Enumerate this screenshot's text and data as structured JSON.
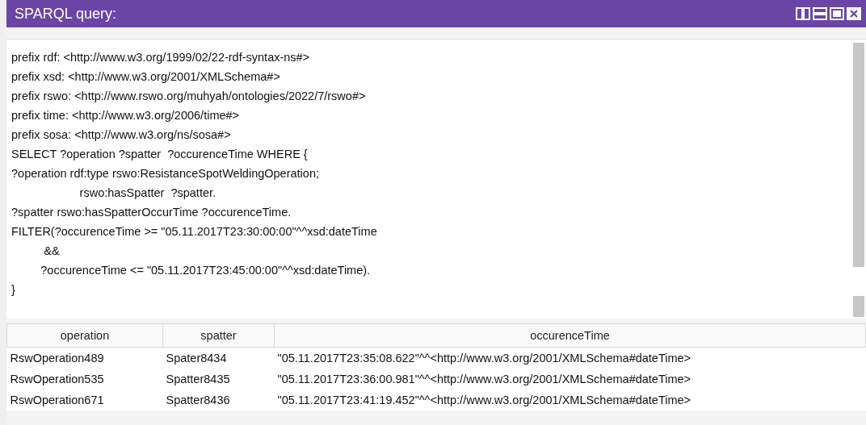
{
  "window": {
    "title": "SPARQL query:"
  },
  "query": {
    "lines": [
      "prefix rdf: <http://www.w3.org/1999/02/22-rdf-syntax-ns#>",
      "prefix xsd: <http://www.w3.org/2001/XMLSchema#>",
      "prefix rswo: <http://www.rswo.org/muhyah/ontologies/2022/7/rswo#>",
      "prefix time: <http://www.w3.org/2006/time#>",
      "prefix sosa: <http://www.w3.org/ns/sosa#>",
      "SELECT ?operation ?spatter  ?occurenceTime WHERE {",
      "?operation rdf:type rswo:ResistanceSpotWeldingOperation;",
      "                     rswo:hasSpatter  ?spatter.",
      "?spatter rswo:hasSpatterOccurTime ?occurenceTime.",
      "FILTER(?occurenceTime >= \"05.11.2017T23:30:00:00\"^^xsd:dateTime",
      "          &&",
      "         ?occurenceTime <= \"05.11.2017T23:45:00:00\"^^xsd:dateTime).",
      "}"
    ]
  },
  "table": {
    "columns": [
      "operation",
      "spatter",
      "occurenceTime"
    ],
    "rows": [
      [
        "RswOperation489",
        "Spater8434",
        "\"05.11.2017T23:35:08.622\"^^<http://www.w3.org/2001/XMLSchema#dateTime>"
      ],
      [
        "RswOperation535",
        "Spatter8435",
        "\"05.11.2017T23:36:00.981\"^^<http://www.w3.org/2001/XMLSchema#dateTime>"
      ],
      [
        "RswOperation671",
        "Spatter8436",
        "\"05.11.2017T23:41:19.452\"^^<http://www.w3.org/2001/XMLSchema#dateTime>"
      ]
    ]
  }
}
